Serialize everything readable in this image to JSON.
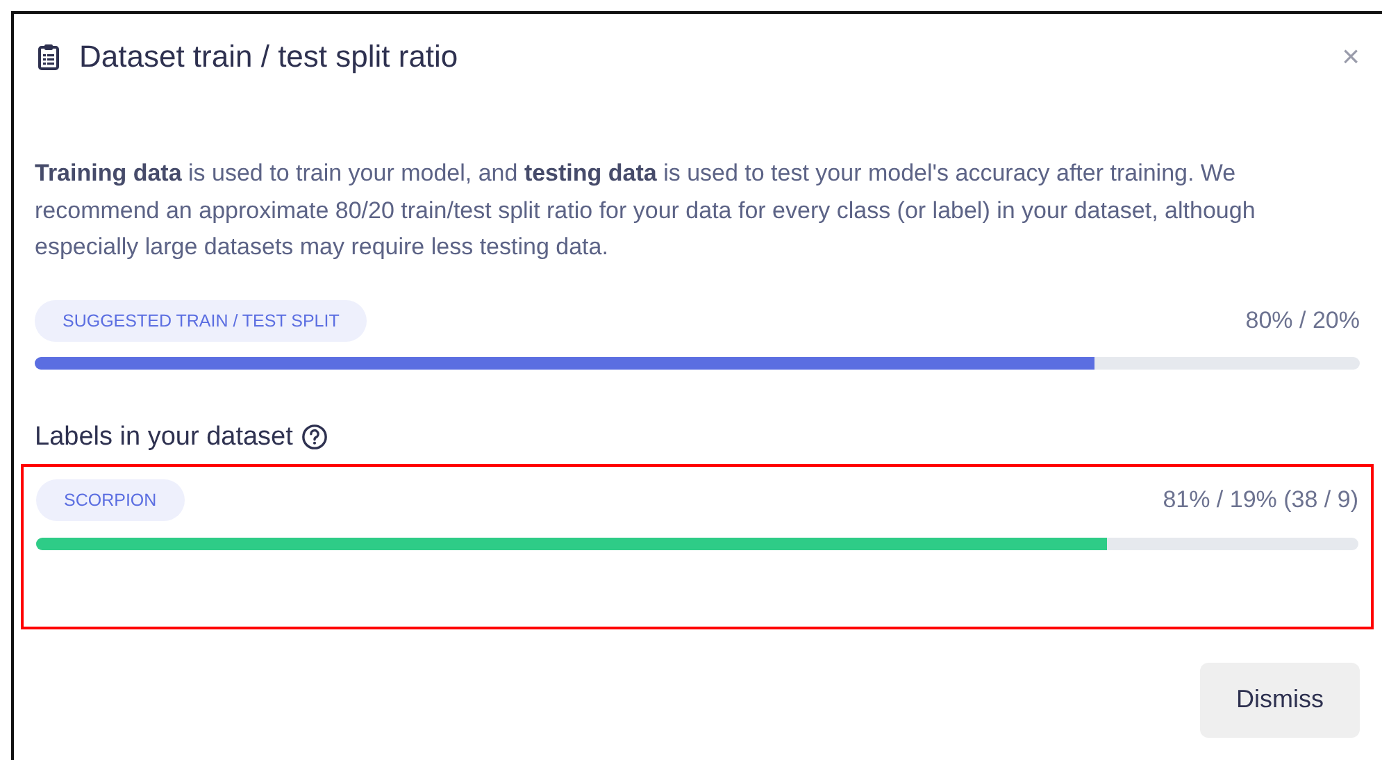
{
  "dialog": {
    "title": "Dataset train / test split ratio",
    "close": "×"
  },
  "description": "**Training data** is used to train your model, and **testing data** is used to test your model's accuracy after training. We recommend an approximate 80/20 train/test split ratio for your data for every class (or label) in your dataset, although especially large datasets may require less testing data.",
  "suggested": {
    "label": "SUGGESTED TRAIN / TEST SPLIT",
    "reading": "80% / 20%",
    "level": 0.8
  },
  "labels_heading": "Labels in your dataset",
  "labels": [
    {
      "label": "SCORPION",
      "reading": "81% / 19% (38 / 9)",
      "level": 0.81,
      "highlighted": true
    }
  ],
  "buttons": [
    "Dismiss"
  ]
}
